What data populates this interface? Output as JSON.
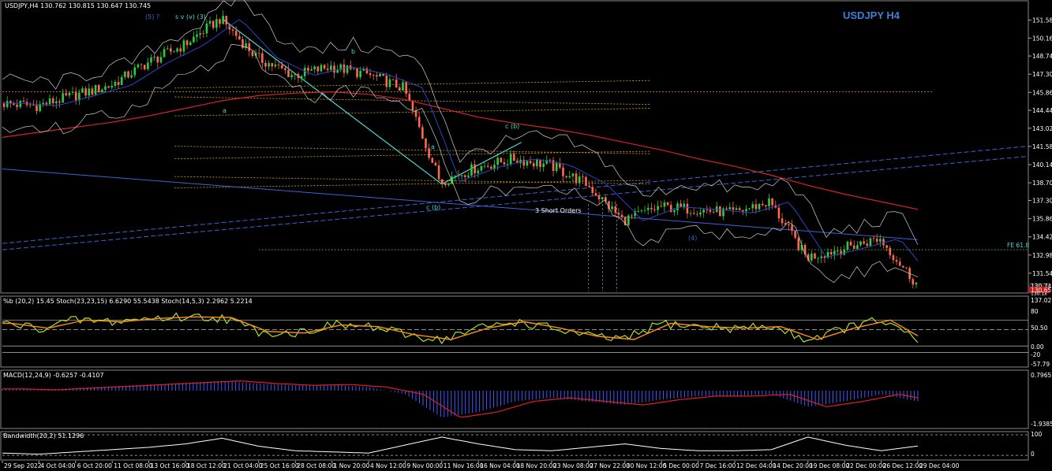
{
  "window": {
    "header": "USDJPY,H4  130.762 130.815 130.647 130.745",
    "watermark": "USDJPY H4"
  },
  "colors": {
    "background": "#000000",
    "bull": "#2ecc40",
    "bear": "#ff6a4d",
    "ma_slow": "#d42424",
    "ma_fast": "#2a46c8",
    "bollinger": "#cfcfcf",
    "fib": "#d9a520",
    "trend_blue": "#3b64d8",
    "cyan": "#4fd6d6",
    "stoch_main": "#a8e31c",
    "stoch_signal": "#ff8c1a",
    "macd_hist": "#4757ff",
    "macd_signal": "#e02020",
    "bandwidth": "#ffffff"
  },
  "labels": {
    "wave_top": "(5) ?",
    "wave_top2": "s  v  (v) (3)",
    "wave_b": "b",
    "wave_a": "a",
    "wave_cb": "c (b)",
    "wave_cb2": "c (b)",
    "wave_small_a": "a",
    "short_orders": "3 Short Orders",
    "fe_label": "FE 61.8",
    "wave_4": "(4)"
  },
  "price_axis": {
    "ticks": [
      "151.580",
      "150.160",
      "148.740",
      "147.300",
      "145.860",
      "144.440",
      "143.020",
      "141.580",
      "140.140",
      "138.700",
      "137.300",
      "135.860",
      "134.420",
      "132.980",
      "131.540"
    ],
    "current_price": "130.745",
    "tag_red": "130.657",
    "tag_bottom": "130.1x"
  },
  "time_axis": {
    "ticks": [
      "29 Sep 2022",
      "4 Oct 04:00",
      "6 Oct 20:00",
      "11 Oct 08:00",
      "13 Oct 16:00",
      "18 Oct 12:00",
      "21 Oct 04:00",
      "25 Oct 16:00",
      "28 Oct 08:00",
      "1 Nov 20:00",
      "4 Nov 12:00",
      "9 Nov 00:00",
      "11 Nov 16:00",
      "16 Nov 04:00",
      "18 Nov 20:00",
      "23 Nov 08:00",
      "27 Nov 22:00",
      "30 Nov 12:00",
      "5 Dec 00:00",
      "7 Dec 16:00",
      "12 Dec 04:00",
      "14 Dec 20:00",
      "19 Dec 08:00",
      "22 Dec 00:00",
      "26 Dec 12:00",
      "29 Dec 04:00"
    ]
  },
  "panels": {
    "stoch": {
      "header": "%b (20,2) 15.45  Stoch(23,23,15) 6.6290 55.5438  Stoch(14,5,3) 2.2962 5.2214",
      "ticks": [
        "137.02",
        "80",
        "50.50",
        "0.00",
        "-20",
        "-57.79"
      ]
    },
    "macd": {
      "header": "MACD(12,24,9) -0.6257 -0.4107",
      "ticks": [
        "0.7965",
        "-1.9385"
      ]
    },
    "bandwidth": {
      "header": "Bandwidth(20,2) 51.1296",
      "ticks": [
        "100",
        "0"
      ]
    }
  },
  "chart_data": {
    "type": "candlestick",
    "title": "USDJPY H4",
    "ylim": [
      130.1,
      152.3
    ],
    "x": [
      "29 Sep 2022",
      "4 Oct 04:00",
      "6 Oct 20:00",
      "11 Oct 08:00",
      "13 Oct 16:00",
      "18 Oct 12:00",
      "21 Oct 04:00",
      "25 Oct 16:00",
      "28 Oct 08:00",
      "1 Nov 20:00",
      "4 Nov 12:00",
      "9 Nov 00:00",
      "11 Nov 16:00",
      "16 Nov 04:00",
      "18 Nov 20:00",
      "23 Nov 08:00",
      "27 Nov 22:00",
      "30 Nov 12:00",
      "5 Dec 00:00",
      "7 Dec 16:00",
      "12 Dec 04:00",
      "14 Dec 20:00",
      "19 Dec 08:00",
      "22 Dec 00:00",
      "26 Dec 12:00",
      "29 Dec 04:00"
    ],
    "close": [
      145.0,
      144.8,
      145.6,
      146.4,
      148.2,
      149.6,
      151.7,
      148.6,
      147.2,
      147.9,
      147.3,
      146.2,
      138.8,
      139.9,
      140.6,
      140.1,
      138.6,
      135.7,
      136.8,
      136.6,
      136.3,
      137.2,
      132.8,
      133.5,
      134.3,
      130.745
    ],
    "series": [
      {
        "name": "MA slow",
        "values": [
          142.3,
          142.7,
          143.1,
          143.5,
          144.0,
          144.6,
          145.2,
          145.6,
          145.8,
          145.9,
          145.7,
          145.3,
          144.6,
          143.9,
          143.4,
          143.0,
          142.5,
          141.9,
          141.3,
          140.6,
          140.0,
          139.3,
          138.5,
          137.8,
          137.2,
          136.6
        ]
      }
    ],
    "stoch": [
      70,
      55,
      80,
      75,
      85,
      90,
      88,
      45,
      40,
      65,
      60,
      35,
      20,
      55,
      75,
      55,
      30,
      20,
      70,
      60,
      55,
      60,
      20,
      55,
      80,
      15
    ],
    "macd": [
      0.1,
      0.05,
      0.15,
      0.25,
      0.35,
      0.45,
      0.55,
      0.4,
      0.3,
      0.35,
      0.2,
      -0.2,
      -1.5,
      -1.2,
      -0.6,
      -0.4,
      -0.6,
      -0.8,
      -0.5,
      -0.3,
      -0.3,
      -0.2,
      -0.9,
      -0.6,
      -0.2,
      -0.6
    ],
    "bandwidth": [
      20,
      15,
      25,
      35,
      45,
      60,
      85,
      50,
      30,
      25,
      20,
      55,
      90,
      60,
      35,
      30,
      45,
      60,
      40,
      30,
      30,
      35,
      90,
      55,
      30,
      51
    ]
  }
}
